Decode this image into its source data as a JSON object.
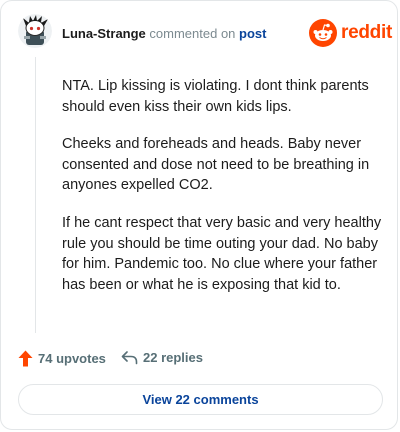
{
  "header": {
    "username": "Luna-Strange",
    "action_text": "commented on",
    "post_link_text": "post",
    "brand_name": "reddit",
    "avatar_icon": "snoo-avatar-icon",
    "brand_icon": "reddit-alien-icon"
  },
  "comment": {
    "paragraphs": [
      "NTA. Lip kissing is violating. I dont think parents should even kiss their own kids lips.",
      "Cheeks and foreheads and heads. Baby never consented and dose not need to be breathing in anyones expelled CO2.",
      "If he cant respect that very basic and very healthy rule you should be time outing your dad. No baby for him. Pandemic too. No clue where your father has been or what he is exposing that kid to."
    ]
  },
  "footer": {
    "upvotes_label": "74 upvotes",
    "replies_label": "22 replies",
    "upvote_icon": "upvote-arrow-icon",
    "reply_icon": "reply-arrow-icon",
    "view_comments_label": "View 22 comments"
  },
  "colors": {
    "brand": "#ff4500",
    "link": "#0a449b",
    "text": "#1c1c1c",
    "muted": "#576f76"
  }
}
